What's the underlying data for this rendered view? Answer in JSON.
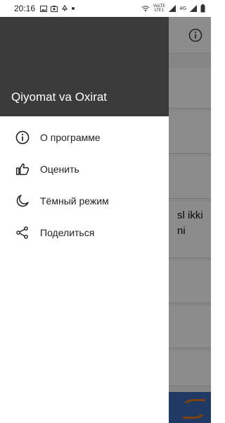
{
  "status_bar": {
    "time": "20:16",
    "network_line1": "VoLTE",
    "network_line2": "LTE1",
    "network_type": "4G",
    "left_icons": [
      "image-icon",
      "media-icon",
      "recycle-icon",
      "dot-icon"
    ],
    "right_icons": [
      "hotspot-icon",
      "signal-icon",
      "signal-icon",
      "battery-icon"
    ]
  },
  "background": {
    "text_line1": "sl ikki",
    "text_line2": "ni"
  },
  "drawer": {
    "title": "Qiyomat va Oxirat",
    "header_color": "#3b3b3b",
    "items": [
      {
        "label": "О программе",
        "icon": "info-icon"
      },
      {
        "label": "Оценить",
        "icon": "thumbs-up-icon"
      },
      {
        "label": "Тёмный режим",
        "icon": "moon-icon"
      },
      {
        "label": "Поделиться",
        "icon": "share-icon"
      }
    ]
  }
}
